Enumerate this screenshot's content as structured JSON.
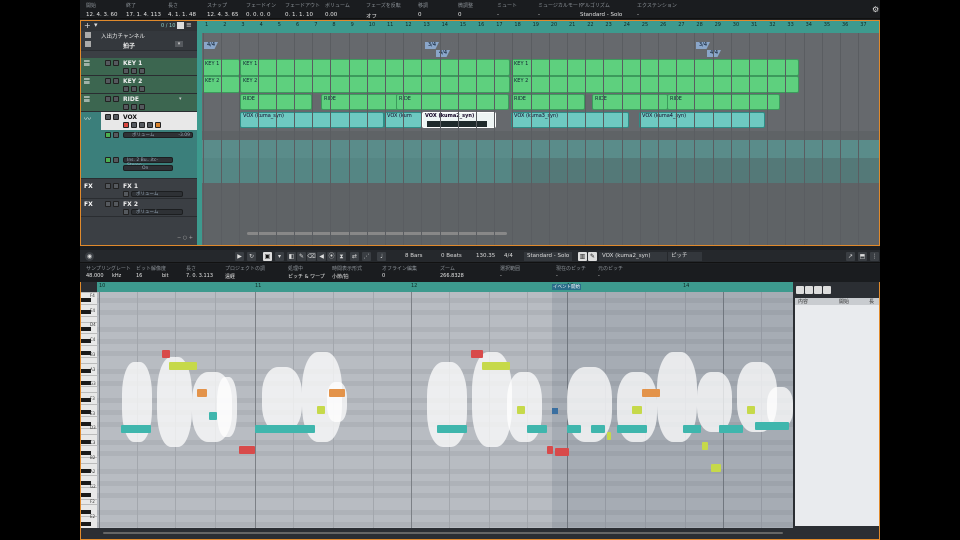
{
  "infoline": {
    "cells": [
      {
        "label": "開始",
        "value": "12. 4. 3. 60"
      },
      {
        "label": "終了",
        "value": "17. 1. 4. 113"
      },
      {
        "label": "長さ",
        "value": "4. 1. 1. 48"
      },
      {
        "label": "スナップ",
        "value": "12. 4. 3. 65"
      },
      {
        "label": "フェードイン",
        "value": "0. 0. 0. 0"
      },
      {
        "label": "フェードアウト",
        "value": "0. 1. 1. 10"
      },
      {
        "label": "ボリューム",
        "value": "0.00"
      },
      {
        "label": "フェーズを反転",
        "value": "オフ"
      },
      {
        "label": "移調",
        "value": "0"
      },
      {
        "label": "微調整",
        "value": "0"
      },
      {
        "label": "ミュート",
        "value": "-"
      },
      {
        "label": "ミュージカルモード",
        "value": "-"
      },
      {
        "label": "アルゴリズム",
        "value": "Standard - Solo"
      },
      {
        "label": "エクステンション",
        "value": "-"
      }
    ]
  },
  "tracklist": {
    "counter": "0 / 10",
    "io_channel": "入出力チャンネル",
    "tracks": [
      {
        "name": "拍子"
      },
      {
        "name": "KEY 1"
      },
      {
        "name": "KEY 2"
      },
      {
        "name": "RIDE"
      },
      {
        "name": "VOX",
        "volume_label": "ボリューム",
        "volume_value": "-3.09",
        "plugin": "Ins. 2 Bu...itc-Stereo",
        "on": "On"
      },
      {
        "name": "FX 1",
        "volume_label": "ボリューム"
      },
      {
        "name": "FX 2",
        "volume_label": "ボリューム"
      }
    ]
  },
  "ruler": {
    "bars": [
      "1",
      "2",
      "3",
      "4",
      "5",
      "6",
      "7",
      "8",
      "9",
      "10",
      "11",
      "12",
      "13",
      "14",
      "15",
      "16",
      "17",
      "18",
      "19",
      "20",
      "21",
      "22",
      "23",
      "24",
      "25",
      "26",
      "27",
      "28",
      "29",
      "30",
      "31",
      "32",
      "33",
      "34",
      "35",
      "36",
      "37"
    ]
  },
  "signatures": [
    "4/4",
    "3/4",
    "4/4",
    "3/4",
    "4/4"
  ],
  "parts": {
    "key1": [
      "KEY 1",
      "KEY 1",
      "KEY 1"
    ],
    "key2": [
      "KEY 2",
      "KEY 2",
      "KEY 2"
    ],
    "ride": [
      "RIDE",
      "RIDE",
      "RIDE",
      "RIDE",
      "RIDE",
      "RIDE"
    ],
    "vox": [
      "VOX (kuma_syn)",
      "VOX (kum",
      "VOX (kuma2_syn)",
      "VOX (kuma3_syn)",
      "VOX (kuma4_syn)"
    ]
  },
  "lower_toolbar": {
    "quantize": "8 Bars",
    "beats": "0 Beats",
    "tempo": "130.35",
    "signature": "4/4",
    "algorithm": "Standard - Solo",
    "event": "VOX (kuma2_syn)",
    "pitch": "ピッチ"
  },
  "variaudio_info": {
    "cells": [
      {
        "label": "サンプリングレート",
        "value": "48.000",
        "unit": "kHz"
      },
      {
        "label": "ビット解像度",
        "value": "16",
        "unit": "bit"
      },
      {
        "label": "長さ",
        "value": "7. 0. 3.113"
      },
      {
        "label": "プロジェクトの調",
        "value": "遠経"
      },
      {
        "label": "処理中",
        "value": "ピッチ & ワープ"
      },
      {
        "label": "時間表示形式",
        "value": "小節/拍"
      },
      {
        "label": "オフライン編集",
        "value": "0"
      },
      {
        "label": "ズーム",
        "value": "266.8328"
      },
      {
        "label": "選択範囲",
        "value": "-"
      },
      {
        "label": "現在のピッチ",
        "value": "-"
      },
      {
        "label": "元のピッチ",
        "value": "-"
      }
    ]
  },
  "editor": {
    "bars": [
      "10",
      "11",
      "12",
      "13",
      "14"
    ],
    "event_start": "イベント開始",
    "keys": [
      "F4",
      "E4",
      "D4",
      "C4",
      "B3",
      "A3",
      "G3",
      "F3",
      "E3",
      "D3",
      "C3",
      "B2",
      "A2",
      "G2",
      "F2",
      "E2"
    ],
    "right_panel_headers": [
      "内容",
      "開始",
      "長"
    ]
  },
  "colors": {
    "project_border": "#e08a2c",
    "midi_part": "#5ed07e",
    "audio_part": "#6ec9c1",
    "ruler": "#3d9a8e",
    "seg_cyan": "#3fb6ad",
    "seg_red": "#d84a4a",
    "seg_yellow": "#c6d94a",
    "seg_orange": "#e3934a"
  }
}
